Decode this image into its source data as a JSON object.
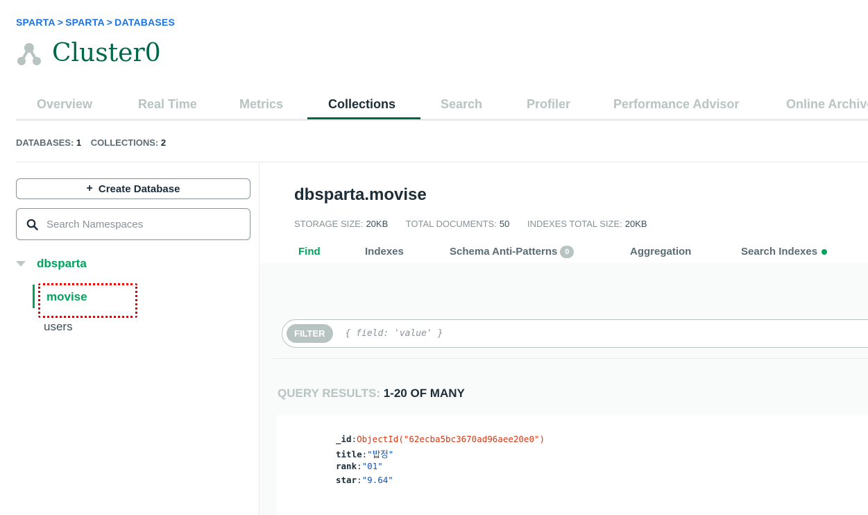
{
  "breadcrumb": [
    "SPARTA",
    "SPARTA",
    "DATABASES"
  ],
  "breadcrumb_sep": ">",
  "cluster": {
    "title": "Cluster0",
    "icon": "cluster-icon"
  },
  "tabs": [
    "Overview",
    "Real Time",
    "Metrics",
    "Collections",
    "Search",
    "Profiler",
    "Performance Advisor",
    "Online Archive"
  ],
  "active_tab": "Collections",
  "counts": {
    "databases_label": "DATABASES:",
    "databases_value": "1",
    "collections_label": "COLLECTIONS:",
    "collections_value": "2"
  },
  "sidebar": {
    "create_plus": "+",
    "create_label": "Create Database",
    "search_placeholder": "Search Namespaces",
    "database": "dbsparta",
    "collections": [
      "movise",
      "users"
    ],
    "active_collection": "movise"
  },
  "namespace": {
    "title": "dbsparta.movise",
    "stats": [
      {
        "label": "STORAGE SIZE:",
        "value": "20KB"
      },
      {
        "label": "TOTAL DOCUMENTS:",
        "value": "50"
      },
      {
        "label": "INDEXES TOTAL SIZE:",
        "value": "20KB"
      }
    ]
  },
  "subtabs": {
    "find": "Find",
    "indexes": "Indexes",
    "schema": "Schema Anti-Patterns",
    "schema_badge": "0",
    "aggregation": "Aggregation",
    "search_indexes": "Search Indexes"
  },
  "filter": {
    "pill": "FILTER",
    "placeholder": "{ field: 'value' }"
  },
  "query_results": {
    "label": "QUERY RESULTS:",
    "count": "1-20 OF MANY"
  },
  "document": {
    "id_key": "_id",
    "id_value": "ObjectId(\"62ecba5bc3670ad96aee20e0\")",
    "title_key": "title",
    "title_value": "\"밥정\"",
    "rank_key": "rank",
    "rank_value": "\"01\"",
    "star_key": "star",
    "star_value": "\"9.64\""
  },
  "colors": {
    "brand_green": "#00684a",
    "accent_green": "#00a35c",
    "link_blue": "#1a73e8",
    "highlight_red": "#e60000"
  }
}
